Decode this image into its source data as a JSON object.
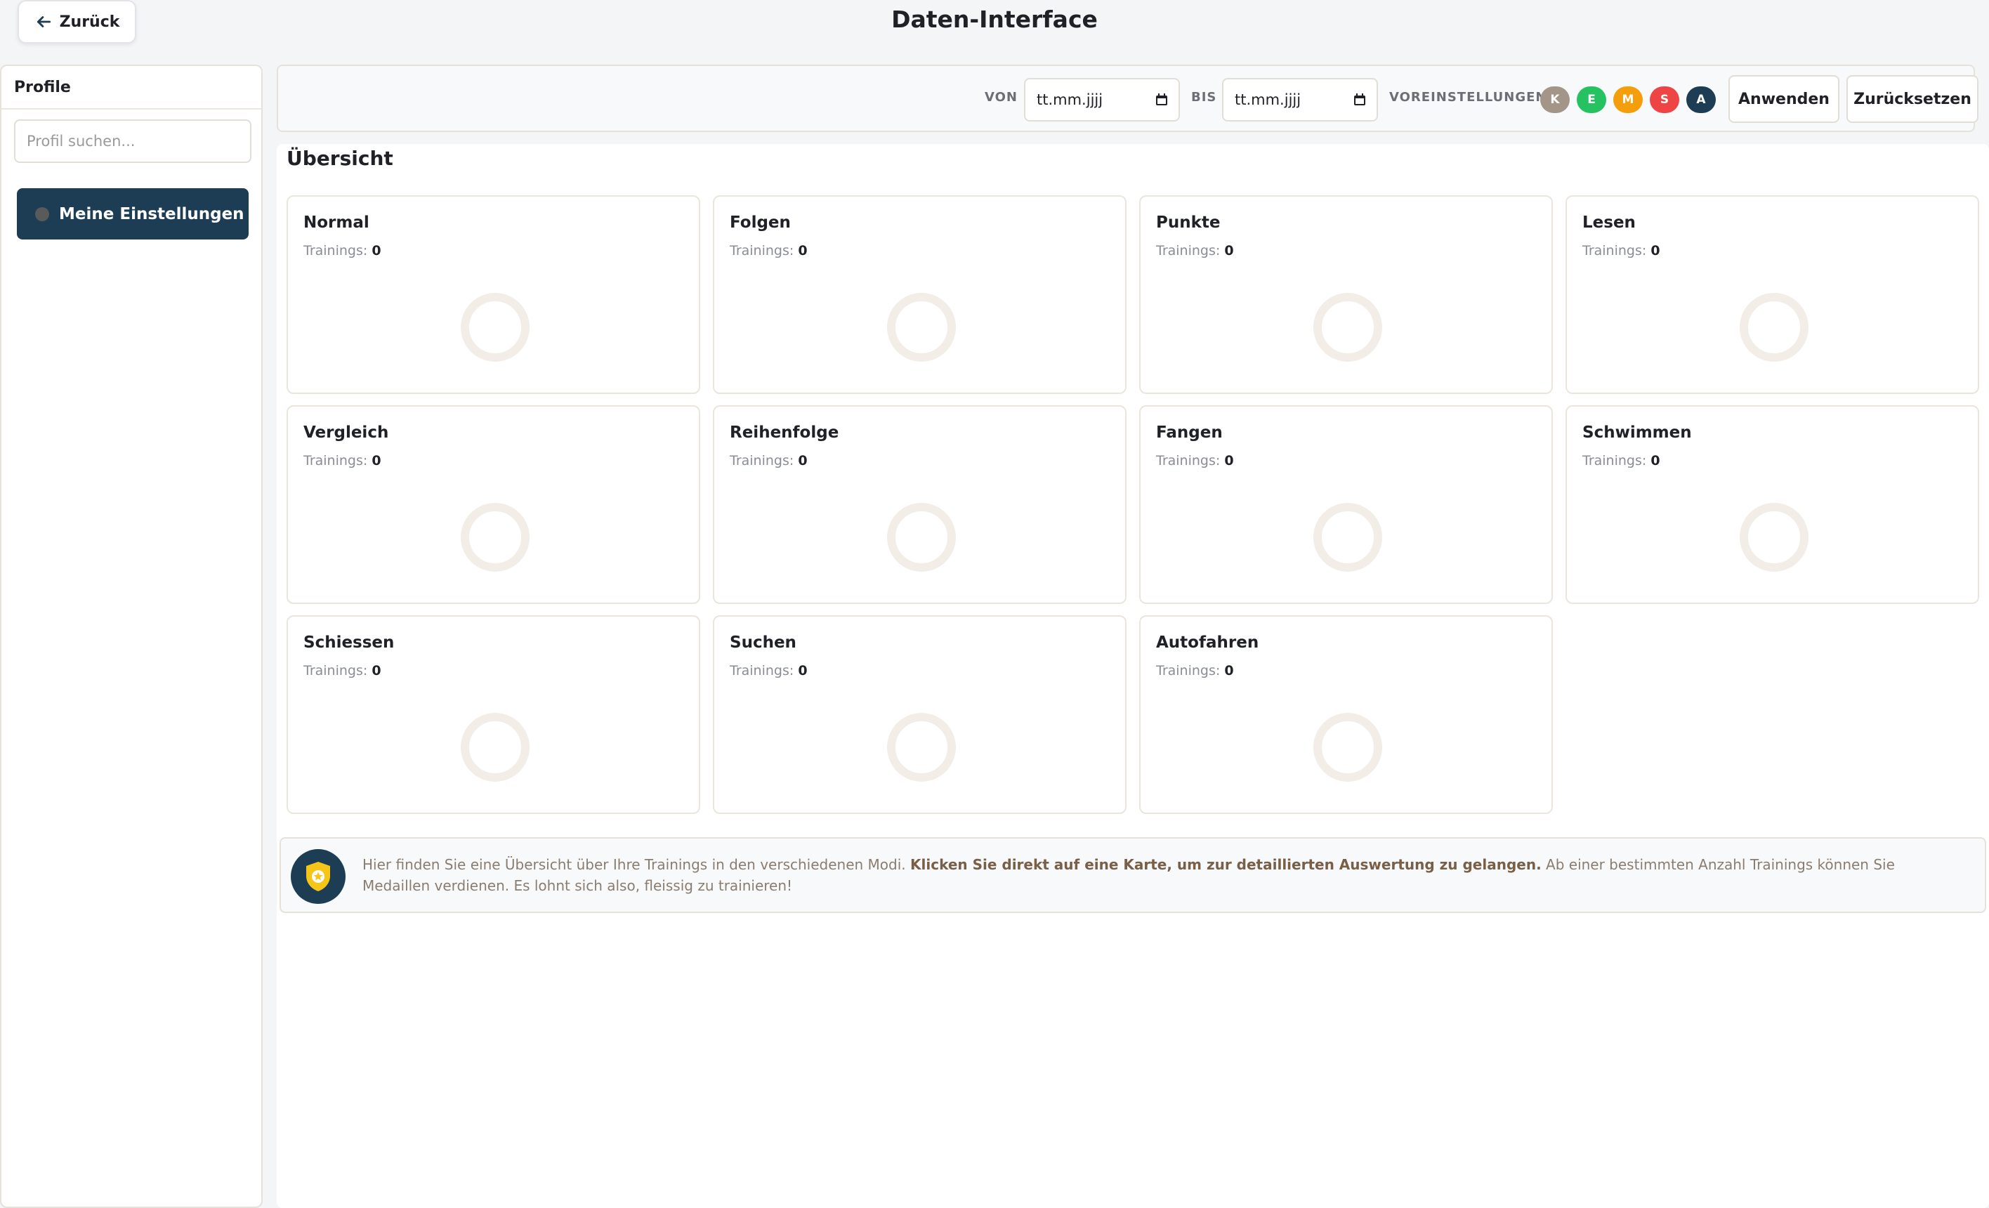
{
  "header": {
    "back_label": "Zurück",
    "title": "Daten-Interface"
  },
  "sidebar": {
    "title": "Profile",
    "search_placeholder": "Profil suchen...",
    "active_profile": "Meine Einstellungen"
  },
  "filters": {
    "from_label": "VON",
    "from_value": "tt.mm.jjjj",
    "to_label": "BIS",
    "to_value": "tt.mm.jjjj",
    "presets_label": "VOREINSTELLUNGEN",
    "presets": [
      {
        "label": "K",
        "color": "#a39689"
      },
      {
        "label": "E",
        "color": "#26c160"
      },
      {
        "label": "M",
        "color": "#f59e0b"
      },
      {
        "label": "S",
        "color": "#ef4444"
      },
      {
        "label": "A",
        "color": "#1d3d55"
      }
    ],
    "apply_label": "Anwenden",
    "reset_label": "Zurücksetzen"
  },
  "overview": {
    "title": "Übersicht",
    "count_label": "Trainings:",
    "cards": [
      {
        "title": "Normal",
        "count": "0"
      },
      {
        "title": "Folgen",
        "count": "0"
      },
      {
        "title": "Punkte",
        "count": "0"
      },
      {
        "title": "Lesen",
        "count": "0"
      },
      {
        "title": "Vergleich",
        "count": "0"
      },
      {
        "title": "Reihenfolge",
        "count": "0"
      },
      {
        "title": "Fangen",
        "count": "0"
      },
      {
        "title": "Schwimmen",
        "count": "0"
      },
      {
        "title": "Schiessen",
        "count": "0"
      },
      {
        "title": "Suchen",
        "count": "0"
      },
      {
        "title": "Autofahren",
        "count": "0"
      }
    ]
  },
  "info": {
    "text_before": "Hier finden Sie eine Übersicht über Ihre Trainings in den verschiedenen Modi. ",
    "text_bold": "Klicken Sie direkt auf eine Karte, um zur detaillierten Auswertung zu gelangen.",
    "text_after": " Ab einer bestimmten Anzahl Trainings können Sie Medaillen verdienen. Es lohnt sich also, fleissig zu trainieren!"
  }
}
